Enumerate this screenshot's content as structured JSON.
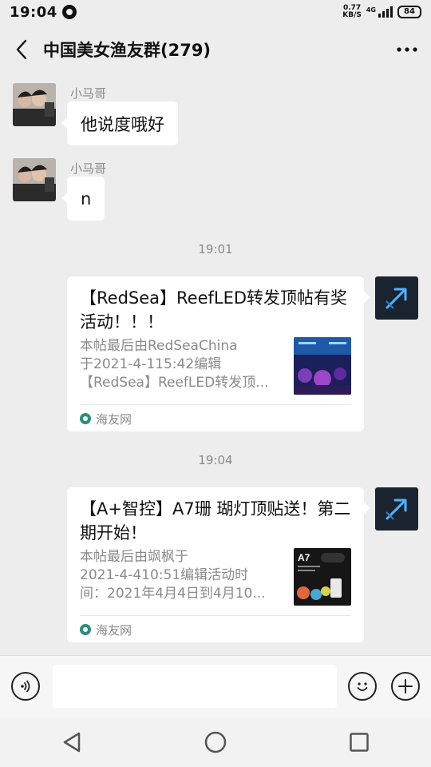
{
  "status_bar": {
    "time": "19:04",
    "net_speed_value": "0.77",
    "net_speed_unit": "KB/S",
    "network_type": "4G",
    "battery": "84"
  },
  "header": {
    "title": "中国美女渔友群(279)",
    "back_icon": "chevron-left-icon",
    "more_icon": "more-horizontal-icon"
  },
  "messages": [
    {
      "type": "text",
      "sender": "小马哥",
      "text": "他说度哦好"
    },
    {
      "type": "text",
      "sender": "小马哥",
      "text": "n"
    },
    {
      "type": "time",
      "text": "19:01"
    },
    {
      "type": "link_card",
      "title": "【RedSea】ReefLED转发顶帖有奖活动！！！",
      "desc_lines": [
        "本帖最后由RedSeaChina",
        "于2021-4-115:42编辑",
        "【RedSea】ReefLED转发顶..."
      ],
      "source": "海友网"
    },
    {
      "type": "time",
      "text": "19:04"
    },
    {
      "type": "link_card",
      "title": "【A+智控】A7珊 瑚灯顶贴送！第二期开始！",
      "desc_lines": [
        "本帖最后由飒枫于",
        "2021-4-410:51编辑活动时",
        "间：2021年4月4日到4月10..."
      ],
      "source": "海友网",
      "thumb_label": "A7"
    }
  ],
  "input_bar": {
    "placeholder": "",
    "voice_icon": "voice-icon",
    "emoji_icon": "emoji-icon",
    "plus_icon": "plus-icon"
  },
  "nav_bar": {
    "back_icon": "triangle-back-icon",
    "home_icon": "circle-home-icon",
    "recents_icon": "square-recents-icon"
  },
  "colors": {
    "background": "#ededed",
    "bubble": "#ffffff",
    "secondary_text": "#8a8a8a",
    "source_icon": "#2a8f7d"
  }
}
